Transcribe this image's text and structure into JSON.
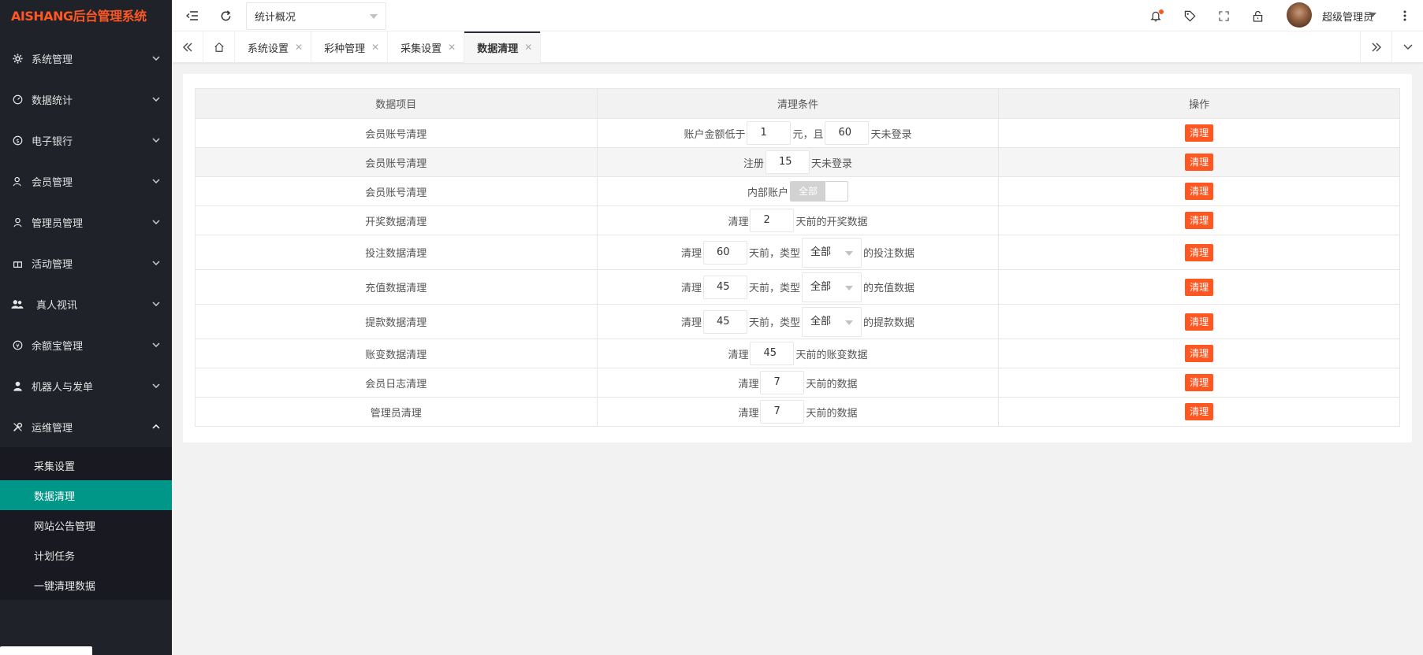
{
  "app": {
    "logo": "AISHANG后台管理系统"
  },
  "sidebar": {
    "items": [
      {
        "label": "系统管理",
        "icon": "gear-icon"
      },
      {
        "label": "数据统计",
        "icon": "dashboard-icon"
      },
      {
        "label": "电子银行",
        "icon": "dollar-icon"
      },
      {
        "label": "会员管理",
        "icon": "user-icon"
      },
      {
        "label": "管理员管理",
        "icon": "user-icon"
      },
      {
        "label": "活动管理",
        "icon": "gift-icon"
      },
      {
        "label": "真人视讯",
        "icon": "group-icon"
      },
      {
        "label": "余额宝管理",
        "icon": "yen-icon"
      },
      {
        "label": "机器人与发单",
        "icon": "person-icon"
      },
      {
        "label": "运维管理",
        "icon": "tools-icon"
      }
    ],
    "sub_items": [
      {
        "label": "采集设置"
      },
      {
        "label": "数据清理"
      },
      {
        "label": "网站公告管理"
      },
      {
        "label": "计划任务"
      },
      {
        "label": "一键清理数据"
      }
    ]
  },
  "header": {
    "select_value": "统计概况",
    "user_name": "超级管理员"
  },
  "tabs": [
    {
      "label": "系统设置"
    },
    {
      "label": "彩种管理"
    },
    {
      "label": "采集设置"
    },
    {
      "label": "数据清理"
    }
  ],
  "table": {
    "headers": [
      "数据项目",
      "清理条件",
      "操作"
    ],
    "action_label": "清理",
    "rows": [
      {
        "item": "会员账号清理",
        "p1": "账户金额低于",
        "v1": "1",
        "p2": "元，且",
        "v2": "60",
        "p3": "天未登录"
      },
      {
        "item": "会员账号清理",
        "p1": "注册",
        "v1": "15",
        "p2": "天未登录"
      },
      {
        "item": "会员账号清理",
        "p1": "内部账户",
        "switch_label": "全部"
      },
      {
        "item": "开奖数据清理",
        "p1": "清理",
        "v1": "2",
        "p2": "天前的开奖数据"
      },
      {
        "item": "投注数据清理",
        "p1": "清理",
        "v1": "60",
        "p2": "天前，类型",
        "sel": "全部",
        "p3": "的投注数据"
      },
      {
        "item": "充值数据清理",
        "p1": "清理",
        "v1": "45",
        "p2": "天前，类型",
        "sel": "全部",
        "p3": "的充值数据"
      },
      {
        "item": "提款数据清理",
        "p1": "清理",
        "v1": "45",
        "p2": "天前，类型",
        "sel": "全部",
        "p3": "的提款数据"
      },
      {
        "item": "账变数据清理",
        "p1": "清理",
        "v1": "45",
        "p2": "天前的账变数据"
      },
      {
        "item": "会员日志清理",
        "p1": "清理",
        "v1": "7",
        "p2": "天前的数据"
      },
      {
        "item": "管理员清理",
        "p1": "清理",
        "v1": "7",
        "p2": "天前的数据"
      }
    ]
  },
  "colors": {
    "sidebar_bg": "#20222a",
    "accent": "#009688",
    "danger": "#ff5722",
    "logo": "#ff5722"
  }
}
